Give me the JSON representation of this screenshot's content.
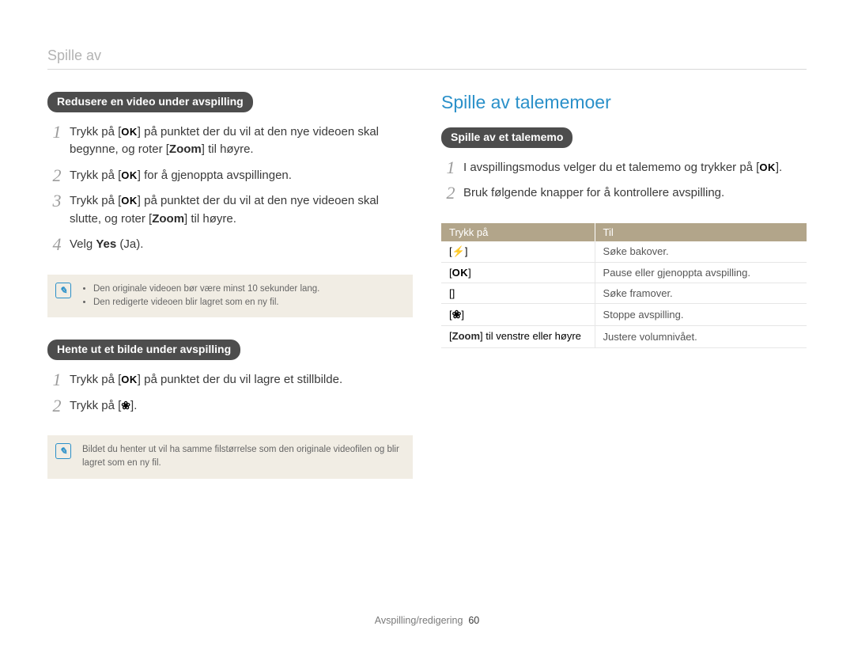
{
  "header": "Spille av",
  "left": {
    "pill1": "Redusere en video under avspilling",
    "steps1": [
      {
        "n": "1",
        "pre": "Trykk på [",
        "icon": "OK",
        "post": "] på punktet der du vil at den nye videoen skal begynne, og roter [",
        "bold": "Zoom",
        "post2": "] til høyre."
      },
      {
        "n": "2",
        "pre": "Trykk på [",
        "icon": "OK",
        "post": "] for å gjenoppta avspillingen."
      },
      {
        "n": "3",
        "pre": "Trykk på [",
        "icon": "OK",
        "post": "] på punktet der du vil at den nye videoen skal slutte, og roter [",
        "bold": "Zoom",
        "post2": "] til høyre."
      },
      {
        "n": "4",
        "pre": "Velg ",
        "bold": "Yes",
        "post": " (Ja)."
      }
    ],
    "note1": [
      "Den originale videoen bør være minst 10 sekunder lang.",
      "Den redigerte videoen blir lagret som en ny fil."
    ],
    "pill2": "Hente ut et bilde under avspilling",
    "steps2": [
      {
        "n": "1",
        "pre": "Trykk på [",
        "icon": "OK",
        "post": "] på punktet der du vil lagre et stillbilde."
      },
      {
        "n": "2",
        "pre": "Trykk på [",
        "icon": "flower",
        "post": "]."
      }
    ],
    "note2": "Bildet du henter ut vil ha samme filstørrelse som den originale videofilen og blir lagret som en ny fil."
  },
  "right": {
    "title": "Spille av talememoer",
    "pill": "Spille av et talememo",
    "steps": [
      {
        "n": "1",
        "pre": "I avspillingsmodus velger du et talememo og trykker på [",
        "icon": "OK",
        "post": "]."
      },
      {
        "n": "2",
        "pre": "Bruk følgende knapper for å kontrollere avspilling."
      }
    ],
    "table": {
      "head": [
        "Trykk på",
        "Til"
      ],
      "rows": [
        {
          "key_open": "[",
          "key_icon": "bolt",
          "key_close": "]",
          "desc": "Søke bakover."
        },
        {
          "key_open": "[",
          "key_icon": "OK",
          "key_close": "]",
          "desc": "Pause eller gjenoppta avspilling."
        },
        {
          "key_open": "[",
          "key_icon": "timer",
          "key_close": "]",
          "desc": "Søke framover."
        },
        {
          "key_open": "[",
          "key_icon": "flower",
          "key_close": "]",
          "desc": "Stoppe avspilling."
        },
        {
          "key_text": "[Zoom] til venstre eller høyre",
          "desc": "Justere volumnivået."
        }
      ]
    }
  },
  "footer": {
    "section": "Avspilling/redigering",
    "page": "60"
  }
}
